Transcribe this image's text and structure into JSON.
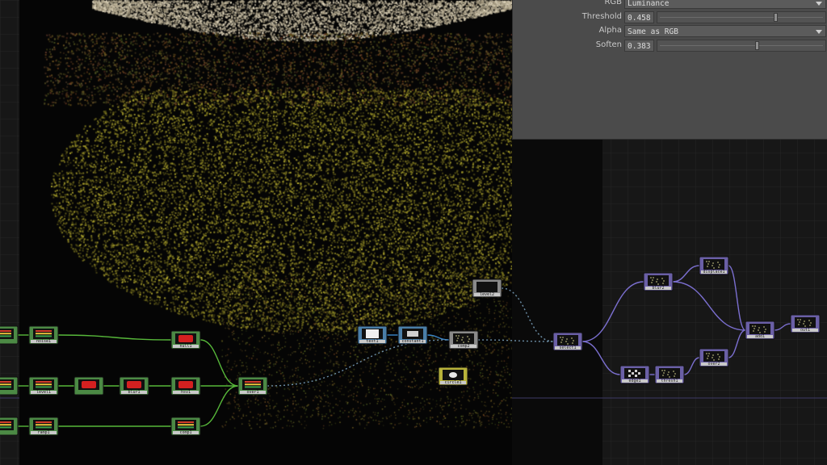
{
  "parameters": {
    "rgb": {
      "label": "RGB",
      "value": "Luminance"
    },
    "threshold": {
      "label": "Threshold",
      "value": "0.458",
      "level": 0.458
    },
    "alpha": {
      "label": "Alpha",
      "value": "Same as RGB"
    },
    "soften": {
      "label": "Soften",
      "value": "0.383",
      "level": 0.383
    }
  },
  "network": {
    "colors": {
      "green_family": "#4c8a45",
      "blue_family": "#4a7ea8",
      "gray_family": "#8a8a8a",
      "yellow_family": "#b8b23a",
      "purple_family": "#6a5fa6",
      "green_wire": "#57b83a",
      "blue_wire": "#3b86c8",
      "purple_wire": "#7b6fd0"
    },
    "nodes": [
      {
        "id": "g1",
        "family": "green",
        "thumb": "bars",
        "label": ""
      },
      {
        "id": "g2",
        "family": "green",
        "thumb": "bars",
        "label": "noise1"
      },
      {
        "id": "g3",
        "family": "green",
        "thumb": "bars",
        "label": ""
      },
      {
        "id": "g4",
        "family": "green",
        "thumb": "bars",
        "label": "level1"
      },
      {
        "id": "g5",
        "family": "green",
        "thumb": "red",
        "label": ""
      },
      {
        "id": "g6",
        "family": "green",
        "thumb": "red",
        "label": "blur1"
      },
      {
        "id": "g7",
        "family": "green",
        "thumb": "red",
        "label": "hsv1"
      },
      {
        "id": "g8",
        "family": "green",
        "thumb": "red",
        "label": "null1"
      },
      {
        "id": "g9",
        "family": "green",
        "thumb": "bars",
        "label": ""
      },
      {
        "id": "g10",
        "family": "green",
        "thumb": "bars",
        "label": "ramp1"
      },
      {
        "id": "g11",
        "family": "green",
        "thumb": "bars",
        "label": "comp1"
      },
      {
        "id": "g12",
        "family": "green",
        "thumb": "bars",
        "label": "over1"
      },
      {
        "id": "b1",
        "family": "blue",
        "thumb": "white",
        "label": "text1"
      },
      {
        "id": "b2",
        "family": "blue",
        "thumb": "mid",
        "label": "constant1"
      },
      {
        "id": "n1",
        "family": "gray",
        "thumb": "dark",
        "label": "level2"
      },
      {
        "id": "n2",
        "family": "gray",
        "thumb": "noise",
        "label": "comp2"
      },
      {
        "id": "y1",
        "family": "yellow",
        "thumb": "circle",
        "label": "circle1"
      },
      {
        "id": "p1",
        "family": "purple",
        "thumb": "noise",
        "label": "select1"
      },
      {
        "id": "p2",
        "family": "purple",
        "thumb": "noise",
        "label": "blur2"
      },
      {
        "id": "p3",
        "family": "purple",
        "thumb": "noise",
        "label": "displace1"
      },
      {
        "id": "p4",
        "family": "purple",
        "thumb": "checker",
        "label": "edge1"
      },
      {
        "id": "p5",
        "family": "purple",
        "thumb": "noise",
        "label": "thresh1"
      },
      {
        "id": "p6",
        "family": "purple",
        "thumb": "noise",
        "label": "over2"
      },
      {
        "id": "p7",
        "family": "purple",
        "thumb": "noise",
        "label": "add1"
      },
      {
        "id": "p8",
        "family": "purple",
        "thumb": "noise",
        "label": "out1"
      }
    ]
  }
}
